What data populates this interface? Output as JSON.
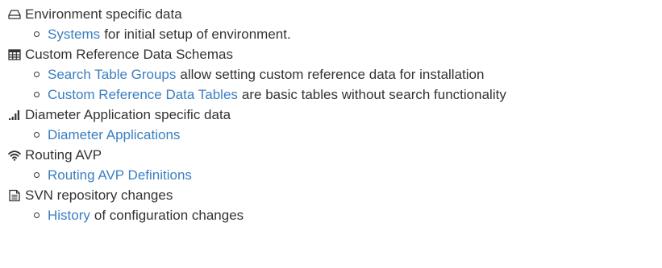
{
  "colors": {
    "text": "#333333",
    "link": "#3a7fc1"
  },
  "sections": [
    {
      "icon": "hdd-drive-icon",
      "title": "Environment specific data",
      "items": [
        {
          "link": "Systems",
          "rest": "for initial setup of environment."
        }
      ]
    },
    {
      "icon": "table-grid-icon",
      "title": "Custom Reference Data Schemas",
      "items": [
        {
          "link": "Search Table Groups",
          "rest": "allow setting custom reference data for installation"
        },
        {
          "link": "Custom Reference Data Tables",
          "rest": "are basic tables without search functionality"
        }
      ]
    },
    {
      "icon": "signal-bars-icon",
      "title": "Diameter Application specific data",
      "items": [
        {
          "link": "Diameter Applications",
          "rest": ""
        }
      ]
    },
    {
      "icon": "wifi-icon",
      "title": "Routing AVP",
      "items": [
        {
          "link": "Routing AVP Definitions",
          "rest": ""
        }
      ]
    },
    {
      "icon": "document-icon",
      "title": "SVN repository changes",
      "items": [
        {
          "link": "History",
          "rest": "of configuration changes"
        }
      ]
    }
  ]
}
